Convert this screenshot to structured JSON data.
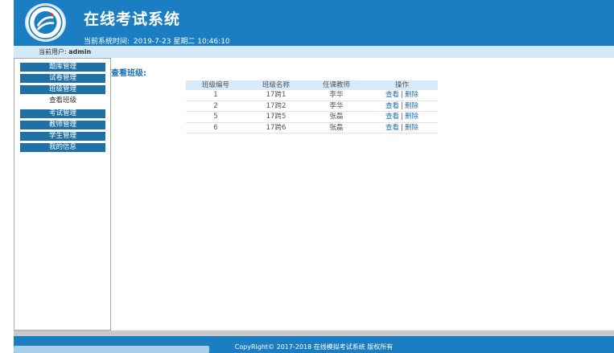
{
  "header": {
    "title": "在线考试系统",
    "time_label": "当前系统时间:",
    "time_value": "2019-7-23 星期二 10:46:10"
  },
  "userbar": {
    "label": "当前用户:",
    "username": "admin"
  },
  "sidebar": {
    "items": [
      {
        "label": "题库管理"
      },
      {
        "label": "试卷管理"
      },
      {
        "label": "班级管理"
      },
      {
        "label": "查看班级"
      },
      {
        "label": "考试管理"
      },
      {
        "label": "教师管理"
      },
      {
        "label": "学生管理"
      },
      {
        "label": "我的信息"
      }
    ]
  },
  "content": {
    "title": "查看班级:",
    "table": {
      "headers": [
        "班级编号",
        "班级名称",
        "任课教师",
        "操作"
      ],
      "rows": [
        {
          "id": "1",
          "name": "17跨1",
          "teacher": "李华"
        },
        {
          "id": "2",
          "name": "17跨2",
          "teacher": "李华"
        },
        {
          "id": "5",
          "name": "17跨5",
          "teacher": "张磊"
        },
        {
          "id": "6",
          "name": "17跨6",
          "teacher": "张磊"
        }
      ],
      "action_view": "查看",
      "action_sep": "|",
      "action_delete": "删除"
    }
  },
  "footer": {
    "copyright": "CopyRight© 2017-2018 在线模拟考试系统 版权所有"
  },
  "colors": {
    "brand": "#1b7ec2",
    "menu": "#1f70a4",
    "userbar": "#d3e9f8",
    "table_header": "#d7eafa"
  }
}
